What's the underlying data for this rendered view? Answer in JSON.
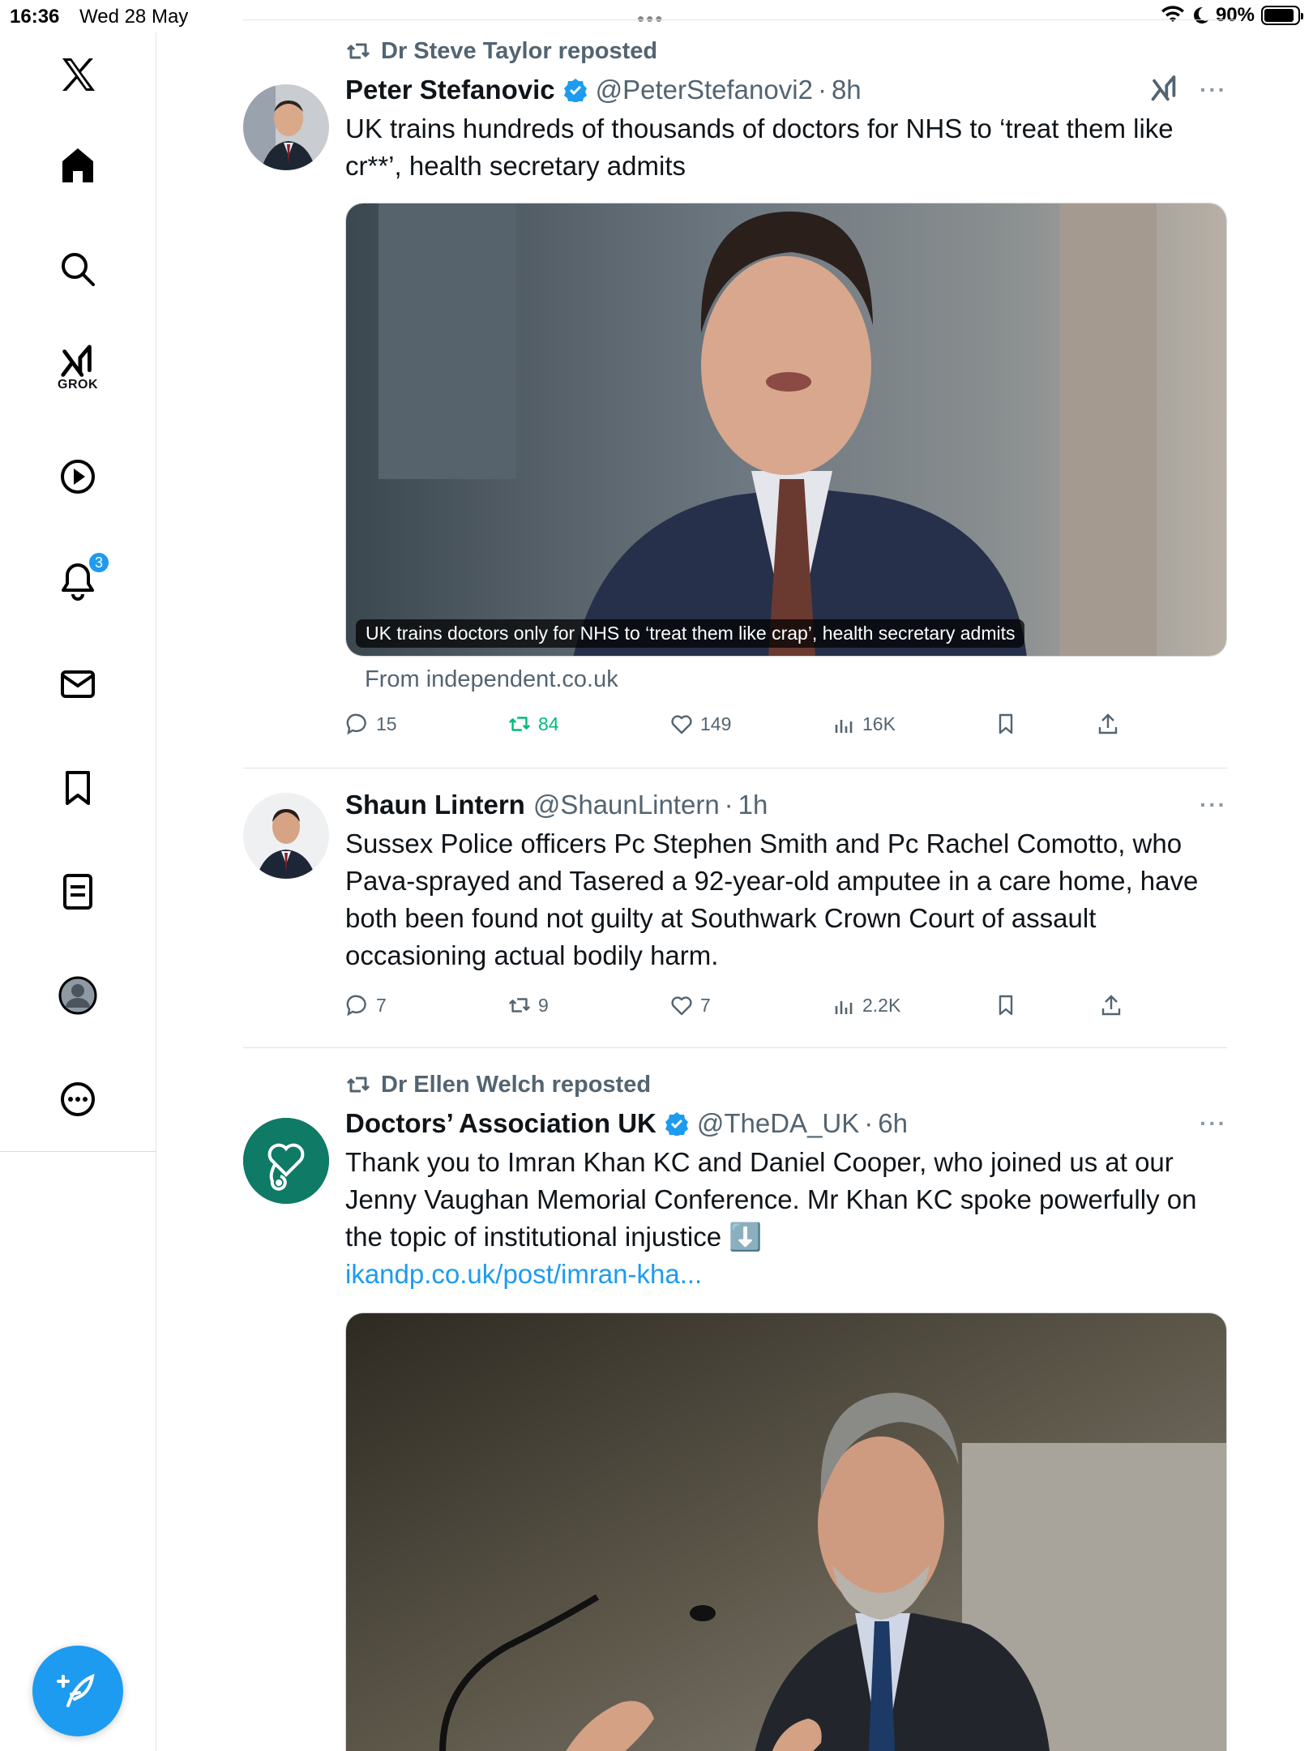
{
  "status_bar": {
    "time": "16:36",
    "date": "Wed 28 May",
    "battery": "90%",
    "battery_level": 0.9
  },
  "sidebar": {
    "items": [
      {
        "icon": "x-logo-icon"
      },
      {
        "icon": "home-icon"
      },
      {
        "icon": "search-icon"
      },
      {
        "icon": "grok-icon",
        "label": "GROK"
      },
      {
        "icon": "video-icon"
      },
      {
        "icon": "notifications-icon",
        "badge": "3"
      },
      {
        "icon": "messages-icon"
      },
      {
        "icon": "bookmarks-icon"
      },
      {
        "icon": "lists-icon"
      },
      {
        "icon": "profile-icon"
      },
      {
        "icon": "more-icon"
      }
    ],
    "compose_icon": "compose-feather-icon"
  },
  "posts": [
    {
      "repost_by": "Dr Steve Taylor reposted",
      "name": "Peter Stefanovic",
      "verified": true,
      "handle": "@PeterStefanovi2",
      "sep": "·",
      "time": "8h",
      "text": "UK trains hundreds of thousands of doctors for NHS to ‘treat them like cr**’, health secretary admits",
      "card_caption": "UK trains doctors only for NHS to ‘treat them like crap’, health secretary admits",
      "card_source": "From independent.co.uk",
      "replies": "15",
      "reposts": "84",
      "likes": "149",
      "views": "16K",
      "reposted_color": "#00ba7c"
    },
    {
      "name": "Shaun Lintern",
      "verified": false,
      "handle": "@ShaunLintern",
      "sep": "·",
      "time": "1h",
      "text": "Sussex Police officers Pc Stephen Smith and Pc Rachel Comotto, who Pava-sprayed and Tasered a 92-year-old amputee in a care home, have both been found not guilty at Southwark Crown Court of assault occasioning actual bodily harm.",
      "replies": "7",
      "reposts": "9",
      "likes": "7",
      "views": "2.2K"
    },
    {
      "repost_by": "Dr Ellen Welch reposted",
      "name": "Doctors’ Association UK",
      "verified": true,
      "handle": "@TheDA_UK",
      "sep": "·",
      "time": "6h",
      "text": "Thank you to Imran Khan KC and Daniel Cooper, who joined us at our Jenny Vaughan Memorial Conference. Mr Khan KC spoke powerfully on the topic of institutional injustice ⬇️",
      "link": "ikandp.co.uk/post/imran-kha..."
    }
  ],
  "more_label": "···",
  "colors": {
    "accent": "#1d9bf0",
    "text": "#0f1419",
    "secondary": "#536471",
    "repost_green": "#00ba7c",
    "da_brand": "#0f7a66"
  }
}
